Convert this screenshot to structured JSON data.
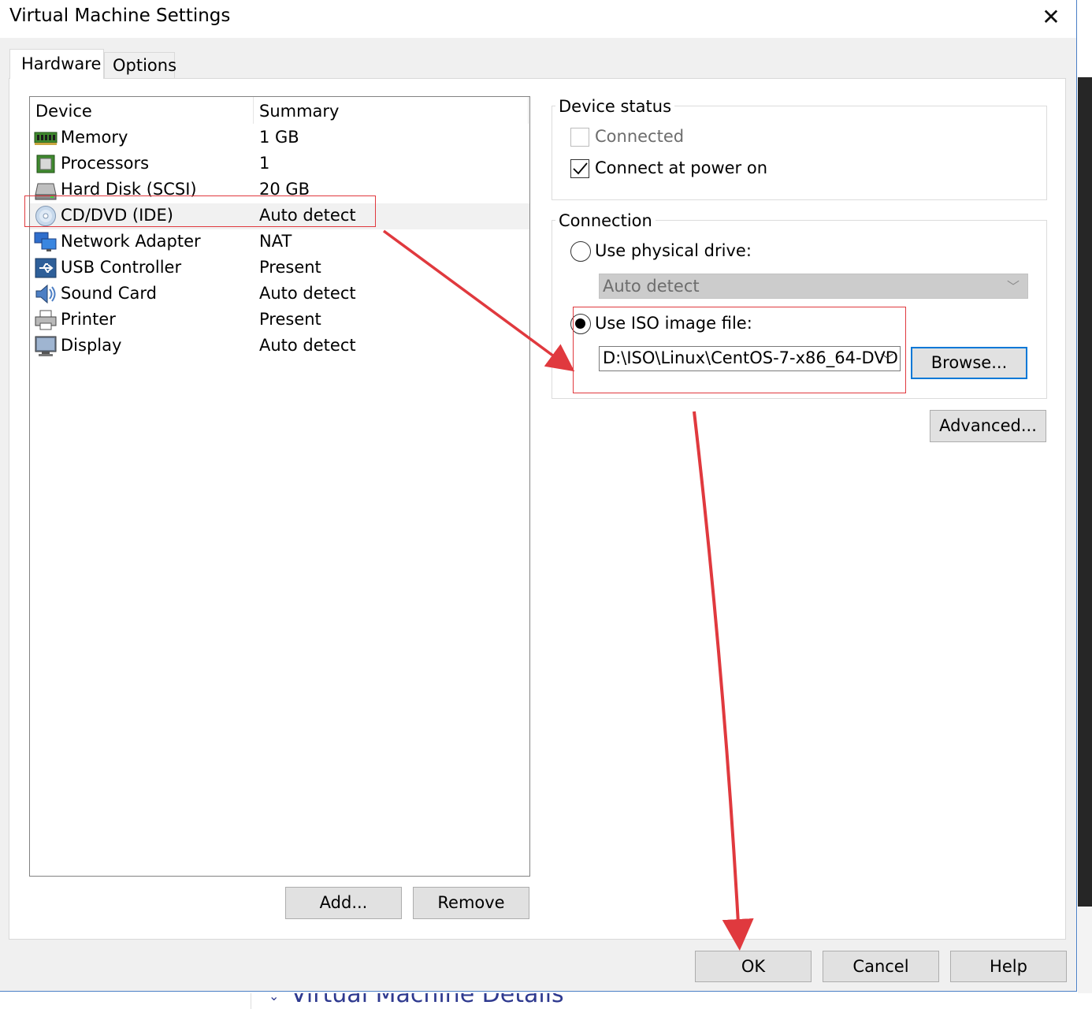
{
  "window": {
    "title": "Virtual Machine Settings",
    "close_glyph": "✕"
  },
  "tabs": [
    {
      "label": "Hardware",
      "active": true
    },
    {
      "label": "Options",
      "active": false
    }
  ],
  "device_list": {
    "columns": {
      "device": "Device",
      "summary": "Summary"
    },
    "rows": [
      {
        "icon": "memory-icon",
        "device": "Memory",
        "summary": "1 GB",
        "selected": false
      },
      {
        "icon": "processor-icon",
        "device": "Processors",
        "summary": "1",
        "selected": false
      },
      {
        "icon": "hard-disk-icon",
        "device": "Hard Disk (SCSI)",
        "summary": "20 GB",
        "selected": false
      },
      {
        "icon": "cd-dvd-icon",
        "device": "CD/DVD (IDE)",
        "summary": "Auto detect",
        "selected": true
      },
      {
        "icon": "network-adapter-icon",
        "device": "Network Adapter",
        "summary": "NAT",
        "selected": false
      },
      {
        "icon": "usb-controller-icon",
        "device": "USB Controller",
        "summary": "Present",
        "selected": false
      },
      {
        "icon": "sound-card-icon",
        "device": "Sound Card",
        "summary": "Auto detect",
        "selected": false
      },
      {
        "icon": "printer-icon",
        "device": "Printer",
        "summary": "Present",
        "selected": false
      },
      {
        "icon": "display-icon",
        "device": "Display",
        "summary": "Auto detect",
        "selected": false
      }
    ],
    "add_label": "Add...",
    "remove_label": "Remove"
  },
  "device_status": {
    "title": "Device status",
    "connected_label": "Connected",
    "connected_checked": false,
    "connect_power_on_label": "Connect at power on",
    "connect_power_on_checked": true
  },
  "connection": {
    "title": "Connection",
    "physical_label": "Use physical drive:",
    "physical_value": "Auto detect",
    "iso_label": "Use ISO image file:",
    "iso_value": "D:\\ISO\\Linux\\CentOS-7-x86_64-DVD",
    "browse_label": "Browse...",
    "selected": "iso"
  },
  "advanced_label": "Advanced...",
  "footer": {
    "ok_label": "OK",
    "cancel_label": "Cancel",
    "help_label": "Help"
  },
  "background": {
    "bottom_text": "Virtual Machine Details"
  },
  "colors": {
    "annotation_red": "#e0393e",
    "focus_blue": "#0078d7"
  }
}
